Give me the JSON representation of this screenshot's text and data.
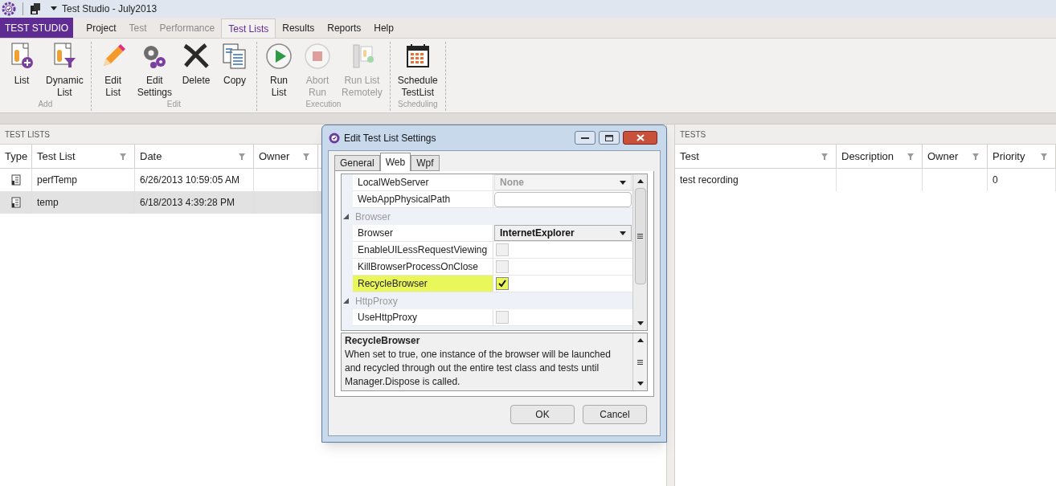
{
  "window": {
    "title": "Test Studio - July2013"
  },
  "app_menu": {
    "label": "TEST STUDIO"
  },
  "ribbon_tabs": [
    {
      "label": "Project",
      "selected": false,
      "disabled": false
    },
    {
      "label": "Test",
      "selected": false,
      "disabled": true
    },
    {
      "label": "Performance",
      "selected": false,
      "disabled": true
    },
    {
      "label": "Test Lists",
      "selected": true,
      "disabled": false
    },
    {
      "label": "Results",
      "selected": false,
      "disabled": false
    },
    {
      "label": "Reports",
      "selected": false,
      "disabled": false
    },
    {
      "label": "Help",
      "selected": false,
      "disabled": false
    }
  ],
  "ribbon_groups": [
    {
      "label": "Add",
      "buttons": [
        {
          "kind": "list",
          "label": "List",
          "disabled": false
        },
        {
          "kind": "dynamic",
          "label": "Dynamic\nList",
          "disabled": false
        }
      ]
    },
    {
      "label": "Edit",
      "buttons": [
        {
          "kind": "pencil",
          "label": "Edit\nList",
          "disabled": false
        },
        {
          "kind": "gears",
          "label": "Edit\nSettings",
          "disabled": false
        },
        {
          "kind": "delete",
          "label": "Delete",
          "disabled": false
        },
        {
          "kind": "copy",
          "label": "Copy",
          "disabled": false
        }
      ]
    },
    {
      "label": "Execution",
      "buttons": [
        {
          "kind": "play",
          "label": "Run\nList",
          "disabled": false
        },
        {
          "kind": "stop",
          "label": "Abort\nRun",
          "disabled": true
        },
        {
          "kind": "remote",
          "label": "Run List\nRemotely",
          "disabled": true
        }
      ]
    },
    {
      "label": "Scheduling",
      "buttons": [
        {
          "kind": "calendar",
          "label": "Schedule\nTestList",
          "disabled": false
        }
      ]
    }
  ],
  "test_lists": {
    "title": "TEST LISTS",
    "columns": [
      "Type",
      "Test List",
      "Date",
      "Owner"
    ],
    "rows": [
      {
        "cells": [
          "",
          "perfTemp",
          "6/26/2013 10:59:05 AM",
          ""
        ],
        "selected": false
      },
      {
        "cells": [
          "",
          "temp",
          "6/18/2013 4:39:28 PM",
          ""
        ],
        "selected": true
      }
    ]
  },
  "tests": {
    "title": "TESTS",
    "columns": [
      "Test",
      "Description",
      "Owner",
      "Priority"
    ],
    "rows": [
      {
        "cells": [
          "test recording",
          "",
          "",
          "0"
        ],
        "selected": false
      }
    ]
  },
  "dialog": {
    "title": "Edit Test List Settings",
    "tabs": [
      {
        "label": "General",
        "selected": false
      },
      {
        "label": "Web",
        "selected": true
      },
      {
        "label": "Wpf",
        "selected": false
      }
    ],
    "properties": [
      {
        "kind": "dropdown",
        "name": "LocalWebServer",
        "value": "None",
        "disabled": true,
        "highlighted": false
      },
      {
        "kind": "text",
        "name": "WebAppPhysicalPath",
        "highlighted": false
      },
      {
        "kind": "category",
        "name": "Browser"
      },
      {
        "kind": "dropdown",
        "name": "Browser",
        "value": "InternetExplorer",
        "disabled": false,
        "highlighted": false
      },
      {
        "kind": "checkbox",
        "name": "EnableUILessRequestViewing",
        "checked": false,
        "highlighted": false
      },
      {
        "kind": "checkbox",
        "name": "KillBrowserProcessOnClose",
        "checked": false,
        "highlighted": false
      },
      {
        "kind": "checkbox",
        "name": "RecycleBrowser",
        "checked": true,
        "highlighted": true
      },
      {
        "kind": "category",
        "name": "HttpProxy"
      },
      {
        "kind": "checkbox",
        "name": "UseHttpProxy",
        "checked": false,
        "highlighted": false
      }
    ],
    "description": {
      "title": "RecycleBrowser",
      "text": "When set to true, one instance of the browser will be launched and recycled through out the entire test class and tests until Manager.Dispose is called."
    },
    "buttons": [
      "OK",
      "Cancel"
    ]
  }
}
